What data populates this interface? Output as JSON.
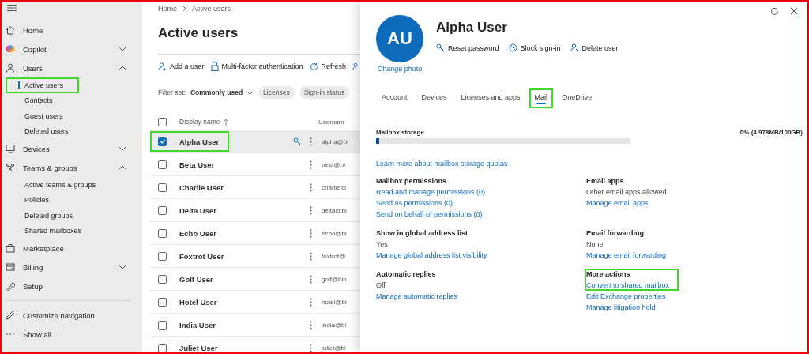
{
  "sidebar": {
    "items": [
      {
        "label": "Home"
      },
      {
        "label": "Copilot",
        "expanded": false
      },
      {
        "label": "Users",
        "expanded": true,
        "children": [
          {
            "label": "Active users",
            "selected": true,
            "highlighted": true
          },
          {
            "label": "Contacts",
            "selected": false,
            "highlighted": false
          },
          {
            "label": "Guest users",
            "selected": false,
            "highlighted": false
          },
          {
            "label": "Deleted users",
            "selected": false,
            "highlighted": false
          }
        ]
      },
      {
        "label": "Devices",
        "expanded": false
      },
      {
        "label": "Teams & groups",
        "expanded": true,
        "children": [
          {
            "label": "Active teams & groups",
            "selected": false,
            "highlighted": false
          },
          {
            "label": "Policies",
            "selected": false,
            "highlighted": false
          },
          {
            "label": "Deleted groups",
            "selected": false,
            "highlighted": false
          },
          {
            "label": "Shared mailboxes",
            "selected": false,
            "highlighted": false
          }
        ]
      },
      {
        "label": "Marketplace"
      },
      {
        "label": "Billing",
        "expanded": false
      },
      {
        "label": "Setup"
      }
    ],
    "footer": [
      "Customize navigation",
      "Show all"
    ]
  },
  "breadcrumb": [
    "Home",
    "Active users"
  ],
  "page_title": "Active users",
  "toolbar": [
    "Add a user",
    "Multi-factor authentication",
    "Refresh"
  ],
  "filter": {
    "label": "Filter set:",
    "value": "Commonly used",
    "chips": [
      "Licenses",
      "Sign-in status"
    ]
  },
  "table": {
    "header_checked": false,
    "columns": [
      "Display name",
      "Usernam"
    ],
    "rows": [
      {
        "name": "Alpha User",
        "username": "alpha@bi",
        "checked": true,
        "selected": true,
        "highlighted": true
      },
      {
        "name": "Beta User",
        "username": "beta@bi",
        "checked": false,
        "selected": false,
        "highlighted": false
      },
      {
        "name": "Charlie User",
        "username": "charlie@",
        "checked": false,
        "selected": false,
        "highlighted": false
      },
      {
        "name": "Delta User",
        "username": "delta@bi",
        "checked": false,
        "selected": false,
        "highlighted": false
      },
      {
        "name": "Echo User",
        "username": "echo@bi",
        "checked": false,
        "selected": false,
        "highlighted": false
      },
      {
        "name": "Foxtrot User",
        "username": "foxtrot@",
        "checked": false,
        "selected": false,
        "highlighted": false
      },
      {
        "name": "Golf User",
        "username": "golf@bin",
        "checked": false,
        "selected": false,
        "highlighted": false
      },
      {
        "name": "Hotel User",
        "username": "hotel@bi",
        "checked": false,
        "selected": false,
        "highlighted": false
      },
      {
        "name": "India User",
        "username": "india@bi",
        "checked": false,
        "selected": false,
        "highlighted": false
      },
      {
        "name": "Juliet User",
        "username": "juliet@bi",
        "checked": false,
        "selected": false,
        "highlighted": false
      }
    ]
  },
  "panel": {
    "initials": "AU",
    "change_photo": "Change photo",
    "name": "Alpha User",
    "actions": [
      "Reset password",
      "Block sign-in",
      "Delete user"
    ],
    "tabs": [
      {
        "label": "Account",
        "selected": false,
        "highlighted": false
      },
      {
        "label": "Devices",
        "selected": false,
        "highlighted": false
      },
      {
        "label": "Licenses and apps",
        "selected": false,
        "highlighted": false
      },
      {
        "label": "Mail",
        "selected": true,
        "highlighted": true
      },
      {
        "label": "OneDrive",
        "selected": false,
        "highlighted": false
      }
    ],
    "storage": {
      "label": "Mailbox storage",
      "reading": "0% (4.978MB/100GB)",
      "level": 0.01,
      "link": "Learn more about mailbox storage quotas"
    },
    "sections": [
      {
        "title": "Mailbox permissions",
        "links": [
          "Read and manage permissions (0)",
          "Send as permissions (0)",
          "Send on behalf of permissions (0)"
        ],
        "highlighted": false
      },
      {
        "title": "Email apps",
        "value": "Other email apps allowed",
        "links": [
          "Manage email apps"
        ],
        "highlighted": false
      },
      {
        "title": "Show in global address list",
        "value": "Yes",
        "links": [
          "Manage global address list visibility"
        ],
        "highlighted": false
      },
      {
        "title": "Email forwarding",
        "value": "None",
        "links": [
          "Manage email forwarding"
        ],
        "highlighted": false
      },
      {
        "title": "Automatic replies",
        "value": "Off",
        "links": [
          "Manage automatic replies"
        ],
        "highlighted": false
      },
      {
        "title": "More actions",
        "links": [
          "Convert to shared mailbox",
          "Edit Exchange properties",
          "Manage litigation hold"
        ],
        "highlighted": true
      }
    ]
  }
}
